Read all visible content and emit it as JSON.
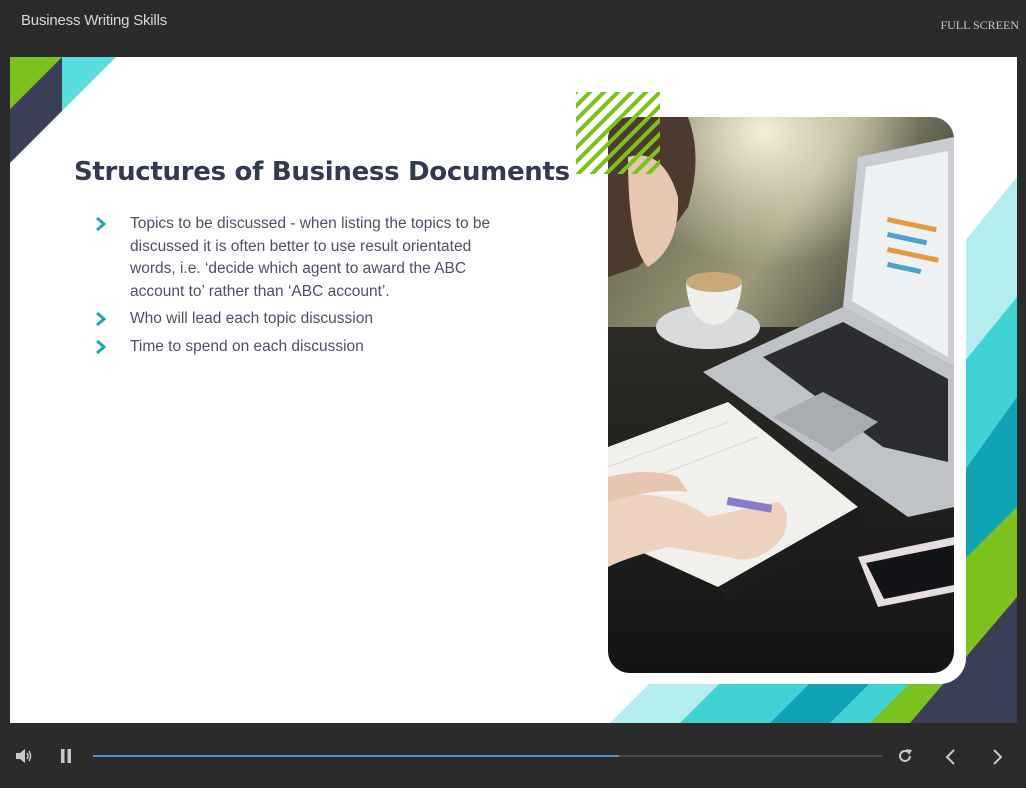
{
  "header": {
    "course_title": "Business Writing Skills",
    "fullscreen_label": "FULL SCREEN"
  },
  "slide": {
    "title": "Structures of Business Documents",
    "bullets": [
      {
        "lines": [
          "Topics to be discussed - when listing the topics to be",
          "discussed it is often better to use result orientated",
          "words, i.e. ‘decide which agent to award the ABC",
          "account to’ rather than ‘ABC account’."
        ]
      },
      {
        "lines": [
          "Who will lead each topic discussion"
        ]
      },
      {
        "lines": [
          "Time to spend on each discussion"
        ]
      }
    ],
    "colors": {
      "title": "#33394f",
      "text": "#4d5165",
      "chevron": "#1aa7b7",
      "green": "#7cc21f",
      "navy": "#3a3f57",
      "teal": "#3fd3d6",
      "dark_teal": "#0fa3b5",
      "light_teal": "#b4eded"
    }
  },
  "player": {
    "progress": 0.667,
    "accent": "#4c8fd2",
    "icons": {
      "volume": "speaker-icon",
      "pause": "pause-icon",
      "replay": "replay-icon",
      "prev": "chevron-left-icon",
      "next": "chevron-right-icon"
    }
  }
}
